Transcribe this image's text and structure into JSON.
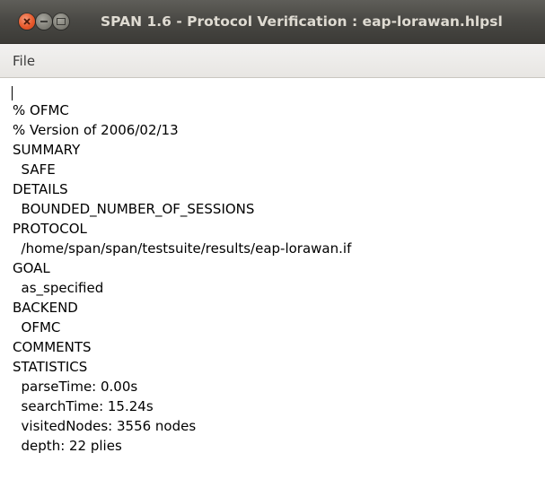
{
  "window": {
    "title": "SPAN 1.6 - Protocol Verification : eap-lorawan.hlpsl",
    "buttons": {
      "close_icon": "close-icon",
      "minimize_icon": "minimize-icon",
      "maximize_icon": "maximize-icon"
    }
  },
  "menubar": {
    "file_label": "File"
  },
  "output": {
    "lines": [
      "% OFMC",
      "% Version of 2006/02/13",
      "SUMMARY",
      "  SAFE",
      "DETAILS",
      "  BOUNDED_NUMBER_OF_SESSIONS",
      "PROTOCOL",
      "  /home/span/span/testsuite/results/eap-lorawan.if",
      "GOAL",
      "  as_specified",
      "BACKEND",
      "  OFMC",
      "COMMENTS",
      "STATISTICS",
      "  parseTime: 0.00s",
      "  searchTime: 15.24s",
      "  visitedNodes: 3556 nodes",
      "  depth: 22 plies"
    ]
  },
  "colors": {
    "titlebar": "#3c3b37",
    "title_text": "#dfdbd2",
    "close_button": "#e8592b",
    "menubar": "#f2f1f0"
  }
}
